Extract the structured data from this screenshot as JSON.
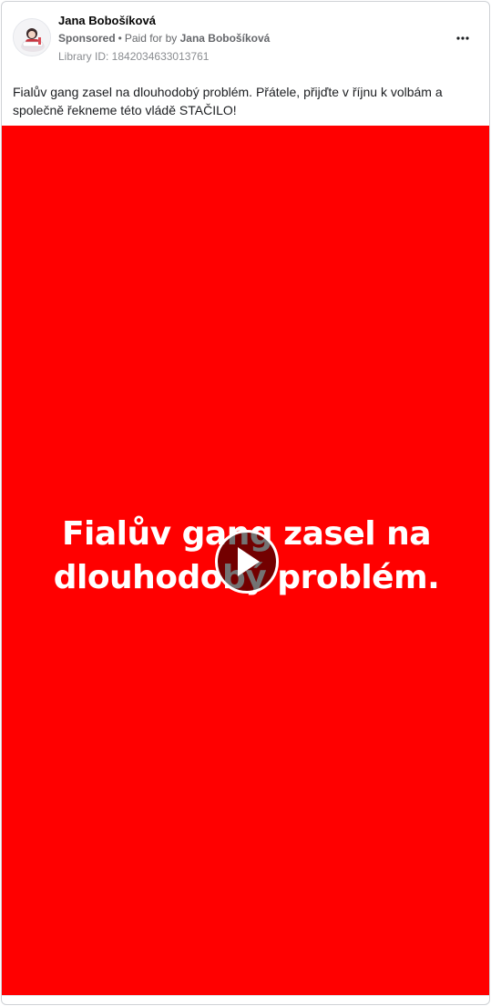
{
  "post": {
    "author": "Jana Bobošíková",
    "sponsored_label": "Sponsored",
    "paid_for_prefix": "Paid for by",
    "paid_for_name": "Jana Bobošíková",
    "library_id": "Library ID: 1842034633013761",
    "text": "Fialův gang zasel na dlouhodobý problém. Přátele, přijďte v říjnu k volbám a společně řekneme této vládě STAČILO!"
  },
  "video": {
    "caption_line1": "Fialův gang zasel na",
    "caption_line2": "dlouhodobý problém.",
    "background_color": "#ff0000"
  },
  "icons": {
    "more": "more-options-icon",
    "play": "play-icon",
    "avatar": "profile-avatar"
  }
}
